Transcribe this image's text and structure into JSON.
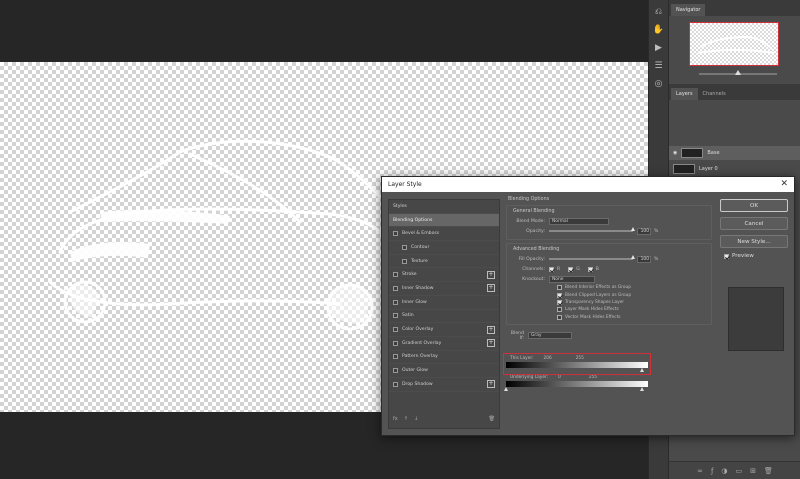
{
  "app": {
    "panels": {
      "navigator_tab": "Navigator",
      "layers_tab": "Layers",
      "channels_tab": "Channels",
      "layers": [
        {
          "name": "Base"
        },
        {
          "name": "Layer 0"
        }
      ]
    }
  },
  "dialog": {
    "title": "Layer Style",
    "styles_header": "Styles",
    "styles": [
      {
        "label": "Blending Options",
        "checkbox": false,
        "plus": false,
        "selected": true,
        "sub": false
      },
      {
        "label": "Bevel & Emboss",
        "checkbox": true,
        "plus": false,
        "selected": false,
        "sub": false
      },
      {
        "label": "Contour",
        "checkbox": true,
        "plus": false,
        "selected": false,
        "sub": true
      },
      {
        "label": "Texture",
        "checkbox": true,
        "plus": false,
        "selected": false,
        "sub": true
      },
      {
        "label": "Stroke",
        "checkbox": true,
        "plus": true,
        "selected": false,
        "sub": false
      },
      {
        "label": "Inner Shadow",
        "checkbox": true,
        "plus": true,
        "selected": false,
        "sub": false
      },
      {
        "label": "Inner Glow",
        "checkbox": true,
        "plus": false,
        "selected": false,
        "sub": false
      },
      {
        "label": "Satin",
        "checkbox": true,
        "plus": false,
        "selected": false,
        "sub": false
      },
      {
        "label": "Color Overlay",
        "checkbox": true,
        "plus": true,
        "selected": false,
        "sub": false
      },
      {
        "label": "Gradient Overlay",
        "checkbox": true,
        "plus": true,
        "selected": false,
        "sub": false
      },
      {
        "label": "Pattern Overlay",
        "checkbox": true,
        "plus": false,
        "selected": false,
        "sub": false
      },
      {
        "label": "Outer Glow",
        "checkbox": true,
        "plus": false,
        "selected": false,
        "sub": false
      },
      {
        "label": "Drop Shadow",
        "checkbox": true,
        "plus": true,
        "selected": false,
        "sub": false
      }
    ],
    "footer": {
      "fx": "fx",
      "up": "↑",
      "down": "↓",
      "trash": "🗑"
    },
    "blending": {
      "section_title": "Blending Options",
      "general_title": "General Blending",
      "blend_mode_label": "Blend Mode:",
      "blend_mode_value": "Normal",
      "opacity_label": "Opacity:",
      "opacity_value": "100",
      "percent": "%",
      "advanced_title": "Advanced Blending",
      "fill_opacity_label": "Fill Opacity:",
      "fill_opacity_value": "100",
      "channels_label": "Channels:",
      "channel_r": "R",
      "channel_g": "G",
      "channel_b": "B",
      "knockout_label": "Knockout:",
      "knockout_value": "None",
      "checks": [
        {
          "label": "Blend Interior Effects as Group",
          "checked": false
        },
        {
          "label": "Blend Clipped Layers as Group",
          "checked": true
        },
        {
          "label": "Transparency Shapes Layer",
          "checked": true
        },
        {
          "label": "Layer Mask Hides Effects",
          "checked": false
        },
        {
          "label": "Vector Mask Hides Effects",
          "checked": false
        }
      ],
      "blend_if_label": "Blend If:",
      "blend_if_value": "Gray",
      "this_layer_label": "This Layer:",
      "this_layer_left": "206",
      "this_layer_right": "255",
      "underlying_label": "Underlying Layer:",
      "underlying_left": "0",
      "underlying_right": "255"
    },
    "buttons": {
      "ok": "OK",
      "cancel": "Cancel",
      "new_style": "New Style...",
      "preview": "Preview"
    }
  },
  "colors": {
    "highlight": "#d0303a"
  }
}
